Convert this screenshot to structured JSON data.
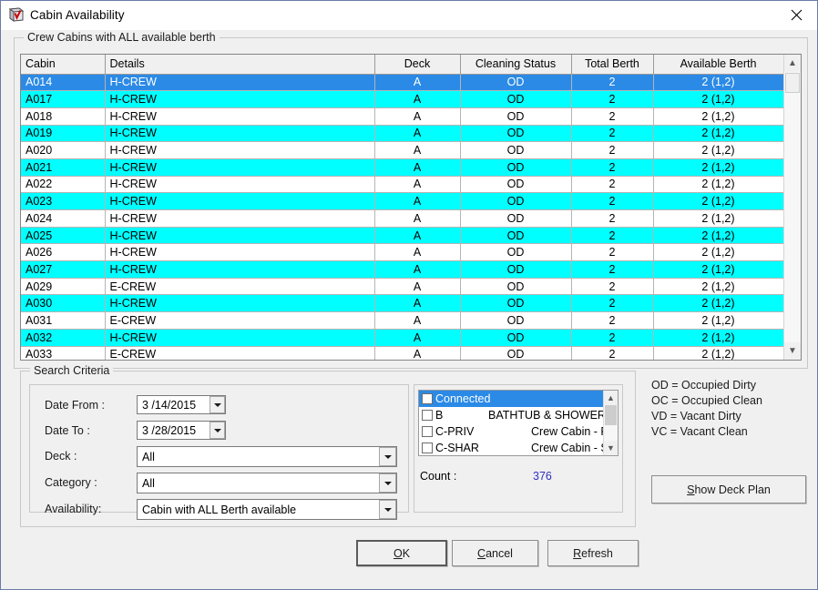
{
  "window": {
    "title": "Cabin Availability",
    "icon": "cabin-book-icon",
    "close_label": "✕"
  },
  "grid_group": {
    "title": "Crew Cabins with ALL available berth"
  },
  "table": {
    "columns": [
      "Cabin",
      "Details",
      "Deck",
      "Cleaning Status",
      "Total Berth",
      "Available Berth"
    ],
    "rows": [
      {
        "cabin": "A014",
        "details": "H-CREW",
        "deck": "A",
        "cleaning": "OD",
        "total": "2",
        "available": "2 (1,2)",
        "state": "selected"
      },
      {
        "cabin": "A017",
        "details": "H-CREW",
        "deck": "A",
        "cleaning": "OD",
        "total": "2",
        "available": "2 (1,2)",
        "state": "cyan"
      },
      {
        "cabin": "A018",
        "details": "H-CREW",
        "deck": "A",
        "cleaning": "OD",
        "total": "2",
        "available": "2 (1,2)",
        "state": "white"
      },
      {
        "cabin": "A019",
        "details": "H-CREW",
        "deck": "A",
        "cleaning": "OD",
        "total": "2",
        "available": "2 (1,2)",
        "state": "cyan"
      },
      {
        "cabin": "A020",
        "details": "H-CREW",
        "deck": "A",
        "cleaning": "OD",
        "total": "2",
        "available": "2 (1,2)",
        "state": "white"
      },
      {
        "cabin": "A021",
        "details": "H-CREW",
        "deck": "A",
        "cleaning": "OD",
        "total": "2",
        "available": "2 (1,2)",
        "state": "cyan"
      },
      {
        "cabin": "A022",
        "details": "H-CREW",
        "deck": "A",
        "cleaning": "OD",
        "total": "2",
        "available": "2 (1,2)",
        "state": "white"
      },
      {
        "cabin": "A023",
        "details": "H-CREW",
        "deck": "A",
        "cleaning": "OD",
        "total": "2",
        "available": "2 (1,2)",
        "state": "cyan"
      },
      {
        "cabin": "A024",
        "details": "H-CREW",
        "deck": "A",
        "cleaning": "OD",
        "total": "2",
        "available": "2 (1,2)",
        "state": "white"
      },
      {
        "cabin": "A025",
        "details": "H-CREW",
        "deck": "A",
        "cleaning": "OD",
        "total": "2",
        "available": "2 (1,2)",
        "state": "cyan"
      },
      {
        "cabin": "A026",
        "details": "H-CREW",
        "deck": "A",
        "cleaning": "OD",
        "total": "2",
        "available": "2 (1,2)",
        "state": "white"
      },
      {
        "cabin": "A027",
        "details": "H-CREW",
        "deck": "A",
        "cleaning": "OD",
        "total": "2",
        "available": "2 (1,2)",
        "state": "cyan"
      },
      {
        "cabin": "A029",
        "details": "E-CREW",
        "deck": "A",
        "cleaning": "OD",
        "total": "2",
        "available": "2 (1,2)",
        "state": "white"
      },
      {
        "cabin": "A030",
        "details": "H-CREW",
        "deck": "A",
        "cleaning": "OD",
        "total": "2",
        "available": "2 (1,2)",
        "state": "cyan"
      },
      {
        "cabin": "A031",
        "details": "E-CREW",
        "deck": "A",
        "cleaning": "OD",
        "total": "2",
        "available": "2 (1,2)",
        "state": "white"
      },
      {
        "cabin": "A032",
        "details": "H-CREW",
        "deck": "A",
        "cleaning": "OD",
        "total": "2",
        "available": "2 (1,2)",
        "state": "cyan"
      },
      {
        "cabin": "A033",
        "details": "E-CREW",
        "deck": "A",
        "cleaning": "OD",
        "total": "2",
        "available": "2 (1,2)",
        "state": "white"
      }
    ]
  },
  "search": {
    "group_title": "Search Criteria",
    "date_from_label": "Date From :",
    "date_from_value": "3 /14/2015",
    "date_to_label": "Date To :",
    "date_to_value": "3 /28/2015",
    "deck_label": "Deck :",
    "deck_value": "All",
    "category_label": "Category :",
    "category_value": "All",
    "availability_label": "Availability:",
    "availability_value": "Cabin with ALL Berth available"
  },
  "feature_list": {
    "items": [
      {
        "code": "Connected",
        "desc": "",
        "checked": false,
        "selected": true
      },
      {
        "code": "B",
        "desc": "BATHTUB & SHOWER",
        "checked": false,
        "selected": false
      },
      {
        "code": "C-PRIV",
        "desc": "Crew Cabin - Pri",
        "checked": false,
        "selected": false
      },
      {
        "code": "C-SHAR",
        "desc": "Crew Cabin - Sh",
        "checked": false,
        "selected": false
      }
    ],
    "count_label": "Count :",
    "count_value": "376"
  },
  "legend": {
    "lines": [
      "OD = Occupied Dirty",
      "OC = Occupied Clean",
      "VD = Vacant Dirty",
      "VC = Vacant Clean"
    ],
    "text": "OD = Occupied Dirty\nOC = Occupied Clean\nVD = Vacant Dirty\nVC = Vacant Clean"
  },
  "buttons": {
    "show_deck_plan": {
      "accel": "S",
      "rest": "how Deck Plan"
    },
    "ok": {
      "accel": "O",
      "rest": "K"
    },
    "cancel": {
      "accel": "C",
      "rest": "ancel"
    },
    "refresh": {
      "accel": "R",
      "rest": "efresh"
    }
  },
  "colors": {
    "row_highlight_cyan": "#00FFFF",
    "row_selected_blue": "#2b8ae6",
    "count_text": "#3030c0",
    "window_bg": "#f0f0f0"
  }
}
